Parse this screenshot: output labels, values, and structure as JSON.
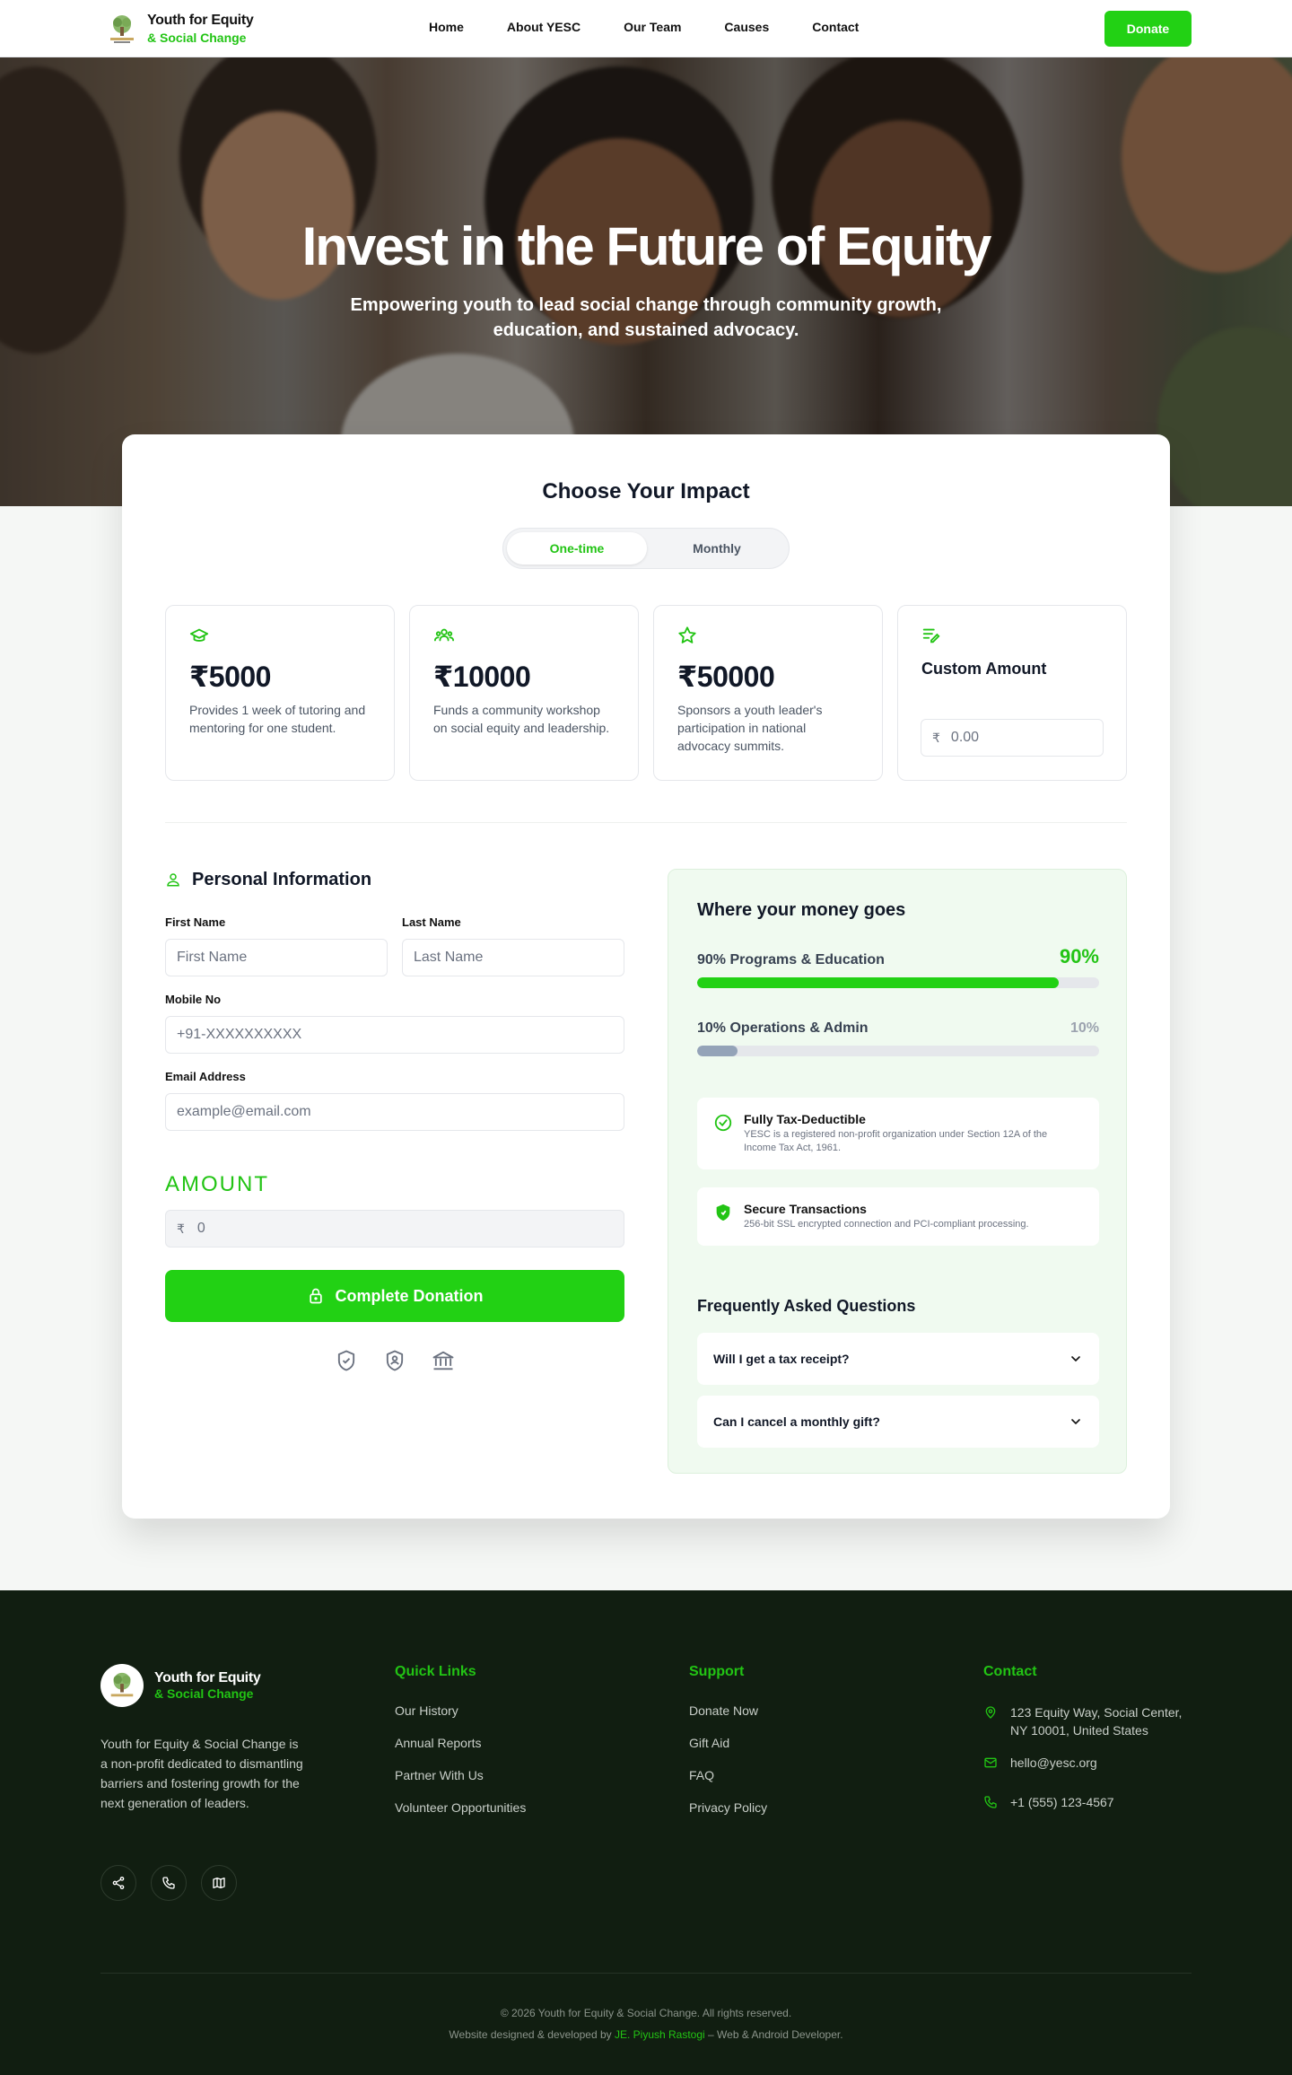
{
  "nav": {
    "logo_line1": "Youth for Equity",
    "logo_line2": "& Social Change",
    "links": [
      "Home",
      "About YESC",
      "Our Team",
      "Causes",
      "Contact"
    ],
    "donate_label": "Donate"
  },
  "hero": {
    "title": "Invest in the Future of Equity",
    "subtitle": "Empowering youth to lead social change through community growth, education, and sustained advocacy."
  },
  "impact": {
    "title": "Choose Your Impact",
    "frequency_options": [
      "One-time",
      "Monthly"
    ],
    "selected_frequency": "One-time",
    "tiers": [
      {
        "icon": "graduation-cap-icon",
        "amount": "₹5000",
        "description": "Provides 1 week of tutoring and mentoring for one student."
      },
      {
        "icon": "community-group-icon",
        "amount": "₹10000",
        "description": "Funds a community workshop on social equity and leadership."
      },
      {
        "icon": "star-icon",
        "amount": "₹50000",
        "description": "Sponsors a youth leader's participation in national advocacy summits."
      }
    ],
    "custom": {
      "icon": "edit-list-icon",
      "label": "Custom Amount",
      "currency": "₹",
      "placeholder": "0.00"
    }
  },
  "form": {
    "section_title": "Personal Information",
    "first_name_label": "First Name",
    "first_name_placeholder": "First Name",
    "last_name_label": "Last Name",
    "last_name_placeholder": "Last Name",
    "mobile_label": "Mobile No",
    "mobile_placeholder": "+91-XXXXXXXXXX",
    "email_label": "Email Address",
    "email_placeholder": "example@email.com",
    "amount_heading": "AMOUNT",
    "amount_currency": "₹",
    "amount_value": "0",
    "submit_label": "Complete Donation"
  },
  "money": {
    "title": "Where your money goes",
    "allocations": [
      {
        "label": "90% Programs & Education",
        "percent_text": "90%",
        "percent": 90,
        "color": "#22d114"
      },
      {
        "label": "10% Operations & Admin",
        "percent_text": "10%",
        "percent": 10,
        "color": "#94a3b8"
      }
    ],
    "badges": [
      {
        "title": "Fully Tax-Deductible",
        "description": "YESC is a registered non-profit organization under Section 12A of the Income Tax Act, 1961."
      },
      {
        "title": "Secure Transactions",
        "description": "256-bit SSL encrypted connection and PCI-compliant processing."
      }
    ],
    "faq_title": "Frequently Asked Questions",
    "faqs": [
      "Will I get a tax receipt?",
      "Can I cancel a monthly gift?"
    ]
  },
  "footer": {
    "logo_line1": "Youth for Equity",
    "logo_line2": "& Social Change",
    "about": "Youth for Equity & Social Change is a non-profit dedicated to dismantling barriers and fostering growth for the next generation of leaders.",
    "quick_links_title": "Quick Links",
    "quick_links": [
      "Our History",
      "Annual Reports",
      "Partner With Us",
      "Volunteer Opportunities"
    ],
    "support_title": "Support",
    "support_links": [
      "Donate Now",
      "Gift Aid",
      "FAQ",
      "Privacy Policy"
    ],
    "contact_title": "Contact",
    "address": "123 Equity Way, Social Center, NY 10001, United States",
    "email": "hello@yesc.org",
    "phone": "+1 (555) 123-4567",
    "copyright": "© 2026 Youth for Equity & Social Change. All rights reserved.",
    "credit_prefix": "Website designed & developed by ",
    "credit_name": "JE. Piyush Rastogi",
    "credit_suffix": " – Web & Android Developer."
  },
  "colors": {
    "accent": "#22d114",
    "footer_bg": "#111e11"
  }
}
